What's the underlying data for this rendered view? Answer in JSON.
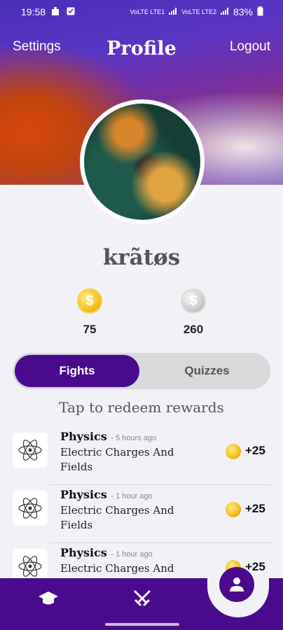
{
  "status_bar": {
    "time": "19:58",
    "network_1": "VoLTE LTE1",
    "network_2": "VoLTE LTE2",
    "battery": "83%"
  },
  "header": {
    "settings_label": "Settings",
    "title": "Profile",
    "logout_label": "Logout"
  },
  "profile": {
    "username": "krãtøs",
    "gold_coins": "75",
    "silver_coins": "260"
  },
  "tabs": [
    {
      "label": "Fights",
      "active": true
    },
    {
      "label": "Quizzes",
      "active": false
    }
  ],
  "hint": "Tap to redeem rewards",
  "rewards": [
    {
      "subject": "Physics",
      "ago": "- 5 hours ago",
      "topic": "Electric Charges And Fields",
      "reward": "+25"
    },
    {
      "subject": "Physics",
      "ago": "- 1 hour ago",
      "topic": "Electric Charges And Fields",
      "reward": "+25"
    },
    {
      "subject": "Physics",
      "ago": "- 1 hour ago",
      "topic": "Electric Charges And Fields",
      "reward": "+25"
    }
  ],
  "colors": {
    "accent": "#4b0a8e",
    "gold": "#f3bd16",
    "silver": "#c8c8c8"
  },
  "nav": {
    "items": [
      "graduation-cap-icon",
      "crossed-swords-icon",
      "profile-icon"
    ],
    "active": "profile-icon"
  }
}
